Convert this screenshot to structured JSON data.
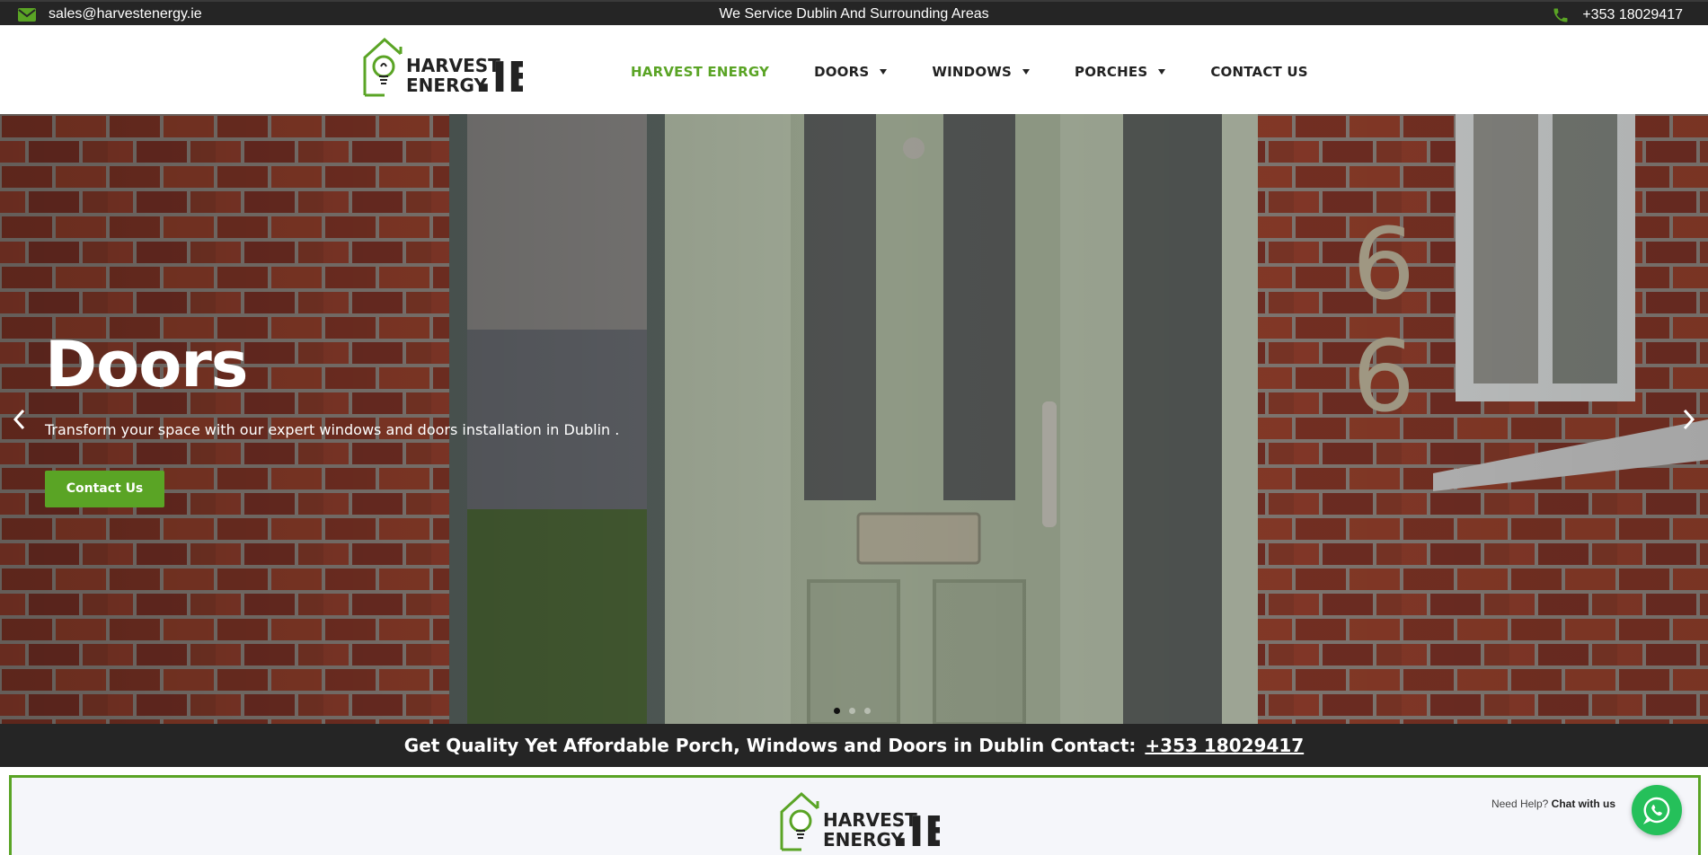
{
  "topbar": {
    "email": "sales@harvestenergy.ie",
    "service_area": "We Service Dublin And Surrounding Areas",
    "phone": "+353 18029417",
    "icons": [
      "envelope-icon",
      "phone-icon"
    ]
  },
  "logo": {
    "line1": "HARVEST",
    "line2": "ENERGY",
    "suffix": ".IE"
  },
  "nav": {
    "items": [
      {
        "label": "HARVEST ENERGY",
        "active": true,
        "dropdown": false
      },
      {
        "label": "DOORS",
        "active": false,
        "dropdown": true
      },
      {
        "label": "WINDOWS",
        "active": false,
        "dropdown": true
      },
      {
        "label": "PORCHES",
        "active": false,
        "dropdown": true
      },
      {
        "label": "CONTACT US",
        "active": false,
        "dropdown": false
      }
    ]
  },
  "hero": {
    "title": "Doors",
    "subtitle": "Transform your space with our expert windows and doors installation in Dublin .",
    "button_label": "Contact Us",
    "house_number": "66",
    "slide_count": 3,
    "active_slide": 1
  },
  "banner": {
    "text": "Get Quality Yet Affordable Porch, Windows and Doors in Dublin Contact:",
    "phone": "+353 18029417"
  },
  "chat": {
    "prefix": "Need Help?",
    "label": "Chat with us"
  },
  "colors": {
    "accent": "#5aa425",
    "dark": "#252525",
    "whatsapp": "#25c05a"
  }
}
